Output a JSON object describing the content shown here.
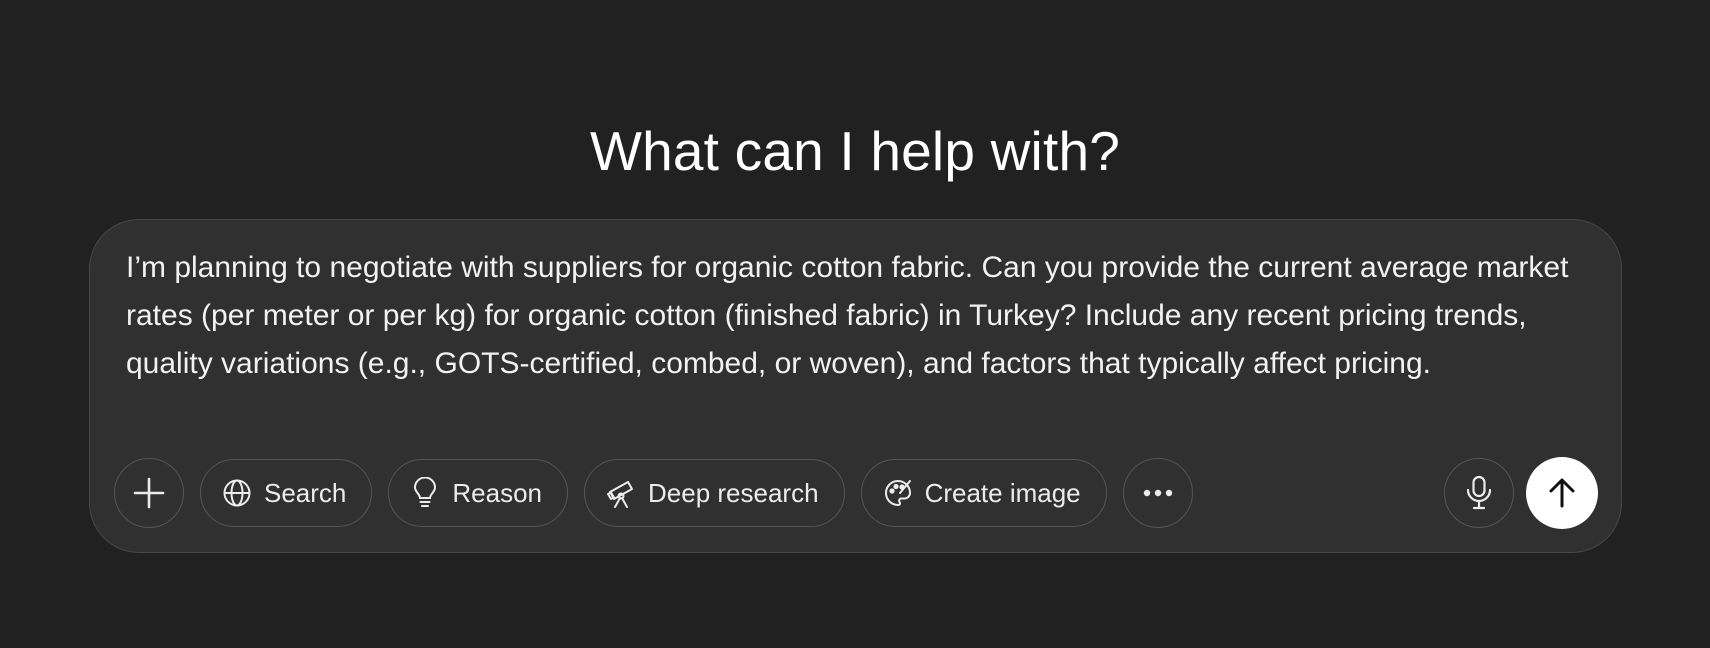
{
  "heading": "What can I help with?",
  "composer": {
    "text": "I’m planning to negotiate with suppliers for organic cotton fabric. Can you provide the current average market rates (per meter or per kg) for organic cotton (finished fabric) in Turkey? Include any recent pricing trends, quality variations (e.g., GOTS-certified, combed, or woven), and factors that typically affect pricing."
  },
  "toolbar": {
    "attach_icon": "plus-icon",
    "tools": [
      {
        "label": "Search",
        "icon": "globe-icon"
      },
      {
        "label": "Reason",
        "icon": "lightbulb-icon"
      },
      {
        "label": "Deep research",
        "icon": "telescope-icon"
      },
      {
        "label": "Create image",
        "icon": "palette-icon"
      }
    ],
    "more_icon": "ellipsis-icon",
    "voice_icon": "microphone-icon",
    "send_icon": "arrow-up-icon"
  },
  "colors": {
    "background": "#212121",
    "composer_bg": "#303030",
    "border": "#555555",
    "text": "#ececec",
    "send_bg": "#ffffff"
  }
}
